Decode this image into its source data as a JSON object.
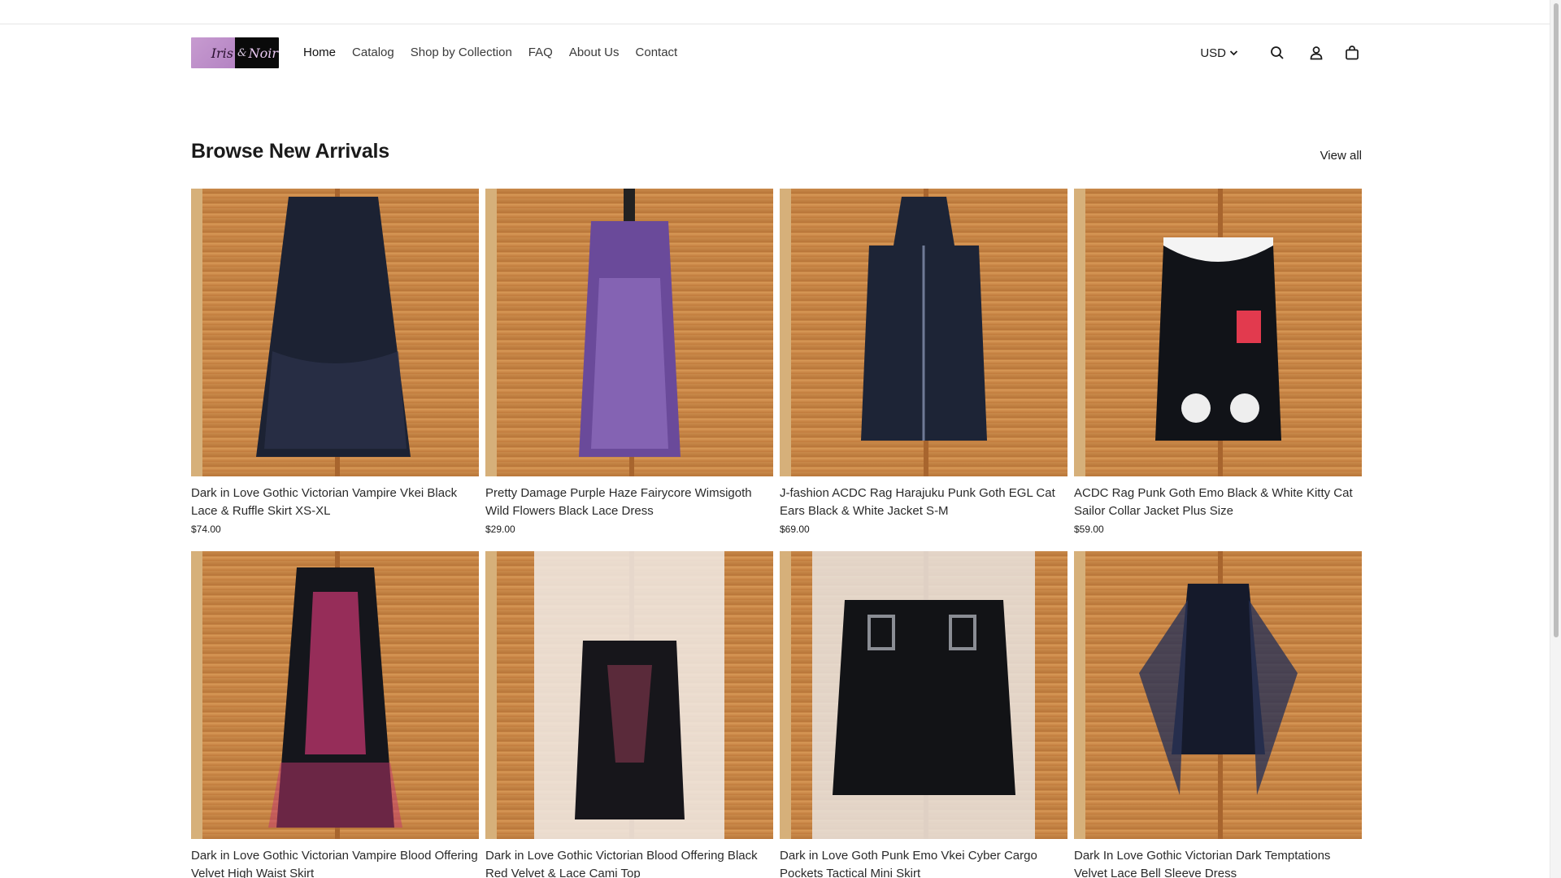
{
  "brand": {
    "logo_left": "Iris",
    "logo_amp": "&",
    "logo_right": "Noir"
  },
  "nav": {
    "items": [
      {
        "label": "Home",
        "active": true
      },
      {
        "label": "Catalog"
      },
      {
        "label": "Shop by Collection"
      },
      {
        "label": "FAQ"
      },
      {
        "label": "About Us"
      },
      {
        "label": "Contact"
      }
    ]
  },
  "header": {
    "currency": "USD",
    "icons": [
      "search-icon",
      "account-icon",
      "cart-icon"
    ]
  },
  "section": {
    "title": "Browse New Arrivals",
    "view_all": "View all"
  },
  "products": [
    {
      "title": "Dark in Love Gothic Victorian Vampire Vkei Black Lace & Ruffle Skirt XS-XL",
      "price": "$74.00",
      "garment_color": "#1c2233",
      "accent": "#2e3650"
    },
    {
      "title": "Pretty Damage Purple Haze Fairycore Wimsigoth Wild Flowers Black Lace Dress",
      "price": "$29.00",
      "garment_color": "#6a4a9a",
      "accent": "#9d7ccc"
    },
    {
      "title": "J-fashion ACDC Rag Harajuku Punk Goth EGL Cat Ears Black & White Jacket S-M",
      "price": "$69.00",
      "garment_color": "#1d2436",
      "accent": "#6f7a96"
    },
    {
      "title": "ACDC Rag Punk Goth Emo Black & White Kitty Cat Sailor Collar Jacket Plus Size",
      "price": "$59.00",
      "garment_color": "#111318",
      "accent": "#e23a4e"
    },
    {
      "title": "Dark in Love Gothic Victorian Vampire Blood Offering Velvet High Waist Skirt",
      "price": "",
      "garment_color": "#15161c",
      "accent": "#c2366e"
    },
    {
      "title": "Dark in Love Gothic Victorian Blood Offering Black Red Velvet & Lace Cami Top",
      "price": "",
      "garment_color": "#17161b",
      "accent": "#5a2a3a"
    },
    {
      "title": "Dark in Love Goth Punk Emo Vkei Cyber Cargo Pockets Tactical Mini Skirt",
      "price": "",
      "garment_color": "#121316",
      "accent": "#8a8d94"
    },
    {
      "title": "Dark In Love Gothic Victorian Dark Temptations Velvet Lace Bell Sleeve Dress",
      "price": "",
      "garment_color": "#151a2b",
      "accent": "#2a3356"
    }
  ]
}
